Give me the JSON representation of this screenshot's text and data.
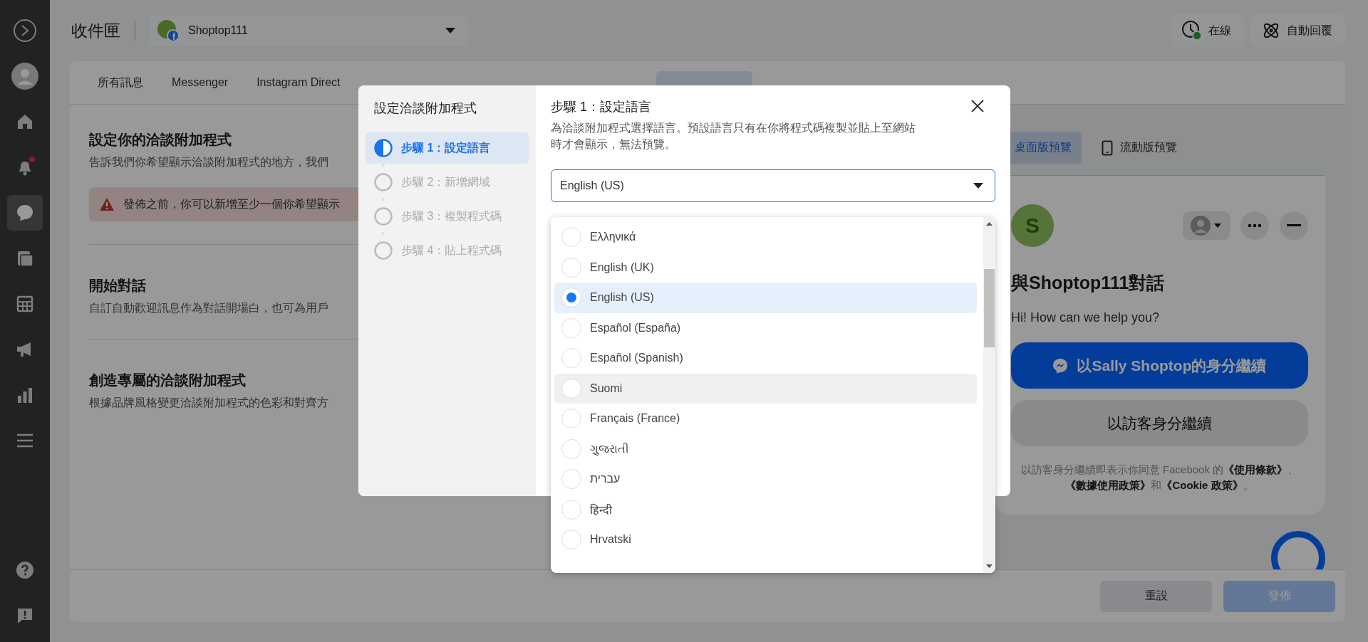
{
  "sidebar": {
    "items": [
      {
        "kind": "logo",
        "selected": false,
        "alert": false
      },
      {
        "kind": "avatar",
        "selected": false,
        "alert": false
      },
      {
        "kind": "home",
        "selected": false,
        "alert": false
      },
      {
        "kind": "bell",
        "selected": false,
        "alert": true
      },
      {
        "kind": "chat",
        "selected": true,
        "alert": false
      },
      {
        "kind": "pages",
        "selected": false,
        "alert": false
      },
      {
        "kind": "table",
        "selected": false,
        "alert": false
      },
      {
        "kind": "megaphone",
        "selected": false,
        "alert": false
      },
      {
        "kind": "chart",
        "selected": false,
        "alert": false
      },
      {
        "kind": "menu",
        "selected": false,
        "alert": false
      }
    ],
    "bottom_items": [
      {
        "kind": "help",
        "selected": false,
        "alert": false
      },
      {
        "kind": "feedback",
        "selected": false,
        "alert": false
      }
    ]
  },
  "header": {
    "title": "收件匣",
    "page_select": {
      "value": "Shoptop111"
    },
    "status_button": {
      "label": "在線",
      "online": true
    },
    "auto_reply_button": {
      "label": "自動回覆"
    }
  },
  "tabs": [
    {
      "label": "所有訊息",
      "selected": false
    },
    {
      "label": "Messenger",
      "selected": false
    },
    {
      "label": "Instagram Direct",
      "selected": false
    },
    {
      "selected": true
    }
  ],
  "sections": [
    {
      "title": "設定你的洽談附加程式",
      "description": "告訴我們你希望顯示洽談附加程式的地方，我們",
      "warning": "發佈之前，你可以新增至少一個你希望顯示"
    },
    {
      "title": "開始對話",
      "description": "自訂自動歡迎訊息作為對話開場白，也可為用戶"
    },
    {
      "title": "創造專屬的洽談附加程式",
      "description": "根據品牌風格變更洽談附加程式的色彩和對齊方"
    }
  ],
  "preview": {
    "tabs": [
      {
        "label": "桌面版預覽",
        "selected": true,
        "kind": "desktop"
      },
      {
        "label": "流動版預覽",
        "selected": false,
        "kind": "mobile"
      }
    ],
    "avatar_letter": "S",
    "title": "與Shoptop111對話",
    "greeting": "Hi! How can we help you?",
    "primary_button": "以Sally Shoptop的身分繼續",
    "secondary_button": "以訪客身分繼續",
    "terms": "以訪客身分繼續即表示你同意 Facebook 的**《使用條款》**、**《數據使用政策》**和**《Cookie 政策》**。"
  },
  "footer": {
    "buttons": [
      {
        "label": "重設",
        "kind": "secondary",
        "disabled": false
      },
      {
        "label": "發佈",
        "kind": "primary",
        "disabled": true
      }
    ]
  },
  "modal": {
    "title": "設定洽談附加程式",
    "steps": [
      {
        "label": "步驟 1：設定語言",
        "selected": true
      },
      {
        "label": "步驟 2：新增網域",
        "selected": false
      },
      {
        "label": "步驟 3：複製程式碼",
        "selected": false
      },
      {
        "label": "步驟 4：貼上程式碼",
        "selected": false
      }
    ],
    "heading": "步驟 1：設定語言",
    "description": "為洽談附加程式選擇語言。預設語言只有在你將程式碼複製並貼上至網站時才會顯示，無法預覽。",
    "select": {
      "value": "English (US)",
      "expanded": true
    },
    "options": [
      {
        "label": "Ελληνικά",
        "selected": false,
        "hovered": false
      },
      {
        "label": "English (UK)",
        "selected": false,
        "hovered": false
      },
      {
        "label": "English (US)",
        "selected": true,
        "hovered": false
      },
      {
        "label": "Español (España)",
        "selected": false,
        "hovered": false
      },
      {
        "label": "Español (Spanish)",
        "selected": false,
        "hovered": false
      },
      {
        "label": "Suomi",
        "selected": false,
        "hovered": true
      },
      {
        "label": "Français (France)",
        "selected": false,
        "hovered": false
      },
      {
        "label": "ગુજરાતી",
        "selected": false,
        "hovered": false
      },
      {
        "label": "עברית",
        "selected": false,
        "hovered": false
      },
      {
        "label": "हिन्दी",
        "selected": false,
        "hovered": false
      },
      {
        "label": "Hrvatski",
        "selected": false,
        "hovered": false
      }
    ]
  }
}
